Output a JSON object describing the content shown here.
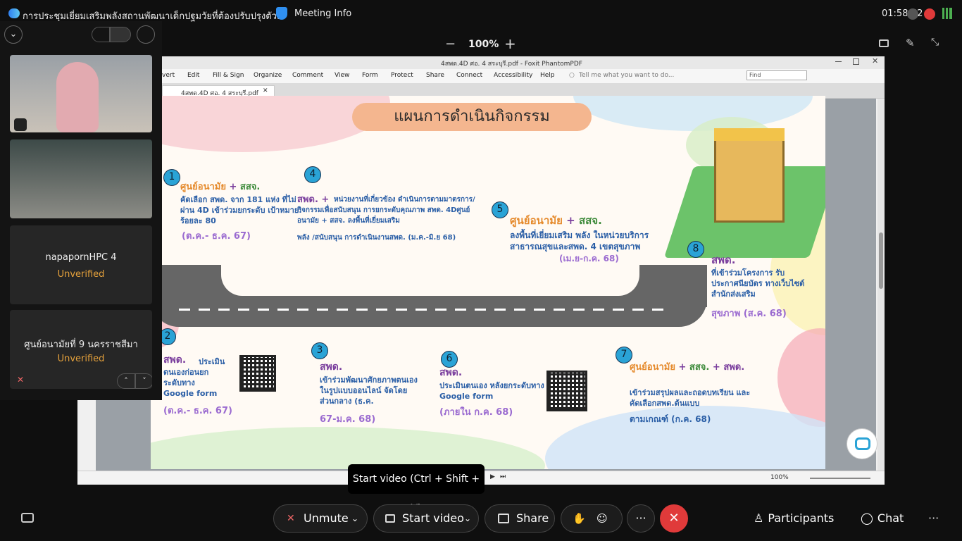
{
  "topbar": {
    "meeting_title": "การประชุมเยี่ยมเสริมพลังสถานพัฒนาเด็กปฐมวัยที่ต้องปรับปรุงตัว...",
    "meeting_info": "Meeting Info",
    "clock": "01:58:52"
  },
  "zoom": {
    "minus": "−",
    "level": "100%",
    "plus": "+"
  },
  "foxit": {
    "window_title": "4สพด.4D ศอ. 4 สระบุรี.pdf - Foxit PhantomPDF",
    "menus": [
      "vert",
      "Edit",
      "Fill & Sign",
      "Organize",
      "Comment",
      "View",
      "Form",
      "Protect",
      "Share",
      "Connect",
      "Accessibility",
      "Help"
    ],
    "tell_me": "Tell me what you want to do...",
    "find_placeholder": "Find",
    "doc_tab": "4สพด.4D ศอ. 4 สระบุรี.pdf",
    "status_zoom": "100%"
  },
  "slide": {
    "title": "แผนการดำเนินกิจกรรม",
    "steps": [
      {
        "num": "1",
        "head_a": "ศูนย์อนามัย",
        "plus": "+",
        "head_b": "สสจ.",
        "body": "คัดเลือก สพด. จาก 181 แห่ง ที่ไม่ผ่าน 4D เข้าร่วมยกระดับ เป้าหมาย: ร้อยละ 80",
        "date": "(ต.ค.- ธ.ค. 67)"
      },
      {
        "num": "2",
        "head_a": "สพด.",
        "body": "ประเมินตนเองก่อนยกระดับทาง Google form",
        "date": "(ต.ค.- ธ.ค. 67)"
      },
      {
        "num": "3",
        "head_a": "สพด.",
        "body": "เข้าร่วมพัฒนาศักยภาพตนเองในรูปแบบออนไลน์ จัดโดยส่วนกลาง (ธ.ค.",
        "date": "67-ม.ค. 68)"
      },
      {
        "num": "4",
        "head_a": "สพด.",
        "plus": "+",
        "body": "หน่วยงานที่เกี่ยวข้อง ดำเนินการตามมาตรการ/กิจกรรมเพื่อสนับสนุน การยกระดับคุณภาพ สพด. 4Dศูนย์อนามัย + สสจ. ลงพื้นที่เยี่ยมเสริม",
        "body2": "พลัง /สนับสนุน การดำเนินงานสพด. (ม.ค.-มิ.ย 68)"
      },
      {
        "num": "5",
        "head_a": "ศูนย์อนามัย",
        "plus": "+",
        "head_b": "สสจ.",
        "body": "ลงพื้นที่เยี่ยมเสริม พลัง ในหน่วยบริการสาธารณสุขและสพด. 4 เขตสุขภาพ",
        "date": "(เม.ย-ก.ค. 68)"
      },
      {
        "num": "6",
        "head_a": "สพด.",
        "body": "ประเมินตนเอง หลังยกระดับทาง Google form",
        "date": "(ภายใน ก.ค. 68)"
      },
      {
        "num": "7",
        "head_a": "ศูนย์อนามัย",
        "plus": "+",
        "head_b": "สสจ.",
        "plus2": "+",
        "head_c": "สพด.",
        "body": "เข้าร่วมสรุปผลและถอดบทเรียน และคัดเลือกสพด.ต้นแบบ",
        "date": "ตามเกณฑ์ (ก.ค. 68)"
      },
      {
        "num": "8",
        "head_a": "สพด.",
        "body": "ที่เข้าร่วมโครงการ รับประกาศนียบัตร ทางเว็บไซต์สำนักส่งเสริม",
        "date": "สุขภาพ (ส.ค. 68)"
      }
    ]
  },
  "participants_panel": {
    "tiles": [
      {
        "name": "napapornHPC 4",
        "status": "Unverified"
      },
      {
        "name": "ศูนย์อนามัยที่ 9 นครราชสีมา",
        "status": "Unverified"
      }
    ]
  },
  "controls": {
    "unmute": "Unmute",
    "start_video": "Start video",
    "share": "Share",
    "more": "···",
    "participants": "Participants",
    "chat": "Chat",
    "overflow": "···",
    "tooltip": "Start video (Ctrl + Shift + V)"
  },
  "colors": {
    "accent_blue": "#2aa3d6",
    "leave_red": "#e03a3a",
    "unverified": "#e6a23c"
  }
}
